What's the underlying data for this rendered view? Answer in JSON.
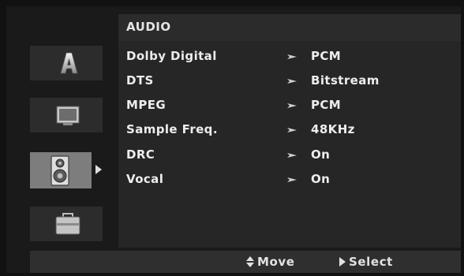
{
  "menu": {
    "title": "AUDIO",
    "items": [
      {
        "label": "Dolby Digital",
        "value": "PCM"
      },
      {
        "label": "DTS",
        "value": "Bitstream"
      },
      {
        "label": "MPEG",
        "value": "PCM"
      },
      {
        "label": "Sample Freq.",
        "value": "48KHz"
      },
      {
        "label": "DRC",
        "value": "On"
      },
      {
        "label": "Vocal",
        "value": "On"
      }
    ]
  },
  "sidebar": {
    "tabs": [
      {
        "icon": "language-a-icon"
      },
      {
        "icon": "tv-display-icon"
      },
      {
        "icon": "speaker-icon"
      },
      {
        "icon": "briefcase-icon"
      }
    ],
    "active_index": 2
  },
  "footer": {
    "move_label": "Move",
    "select_label": "Select"
  },
  "colors": {
    "background": "#1a1a1a",
    "panel": "#262626",
    "active_tab": "#7d7d7d",
    "text": "#ececec"
  }
}
